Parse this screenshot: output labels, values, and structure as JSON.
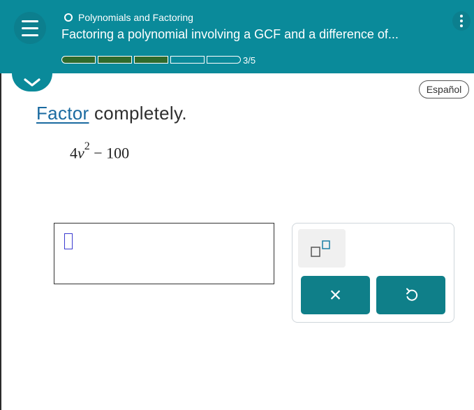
{
  "header": {
    "topic": "Polynomials and Factoring",
    "lesson_title": "Factoring a polynomial involving a GCF and a difference of...",
    "progress": {
      "completed": 3,
      "total": 5,
      "label": "3/5"
    }
  },
  "language_button": "Español",
  "problem": {
    "prompt_link": "Factor",
    "prompt_rest": " completely.",
    "expression": {
      "coefficient": "4",
      "variable": "v",
      "exponent": "2",
      "rest": " − 100"
    }
  },
  "keypad": {
    "clear_symbol": "×"
  },
  "colors": {
    "header": "#0a8a9a",
    "progress_fill": "#2f6a2c",
    "key": "#0f7f89",
    "link": "#1a6aa0"
  }
}
